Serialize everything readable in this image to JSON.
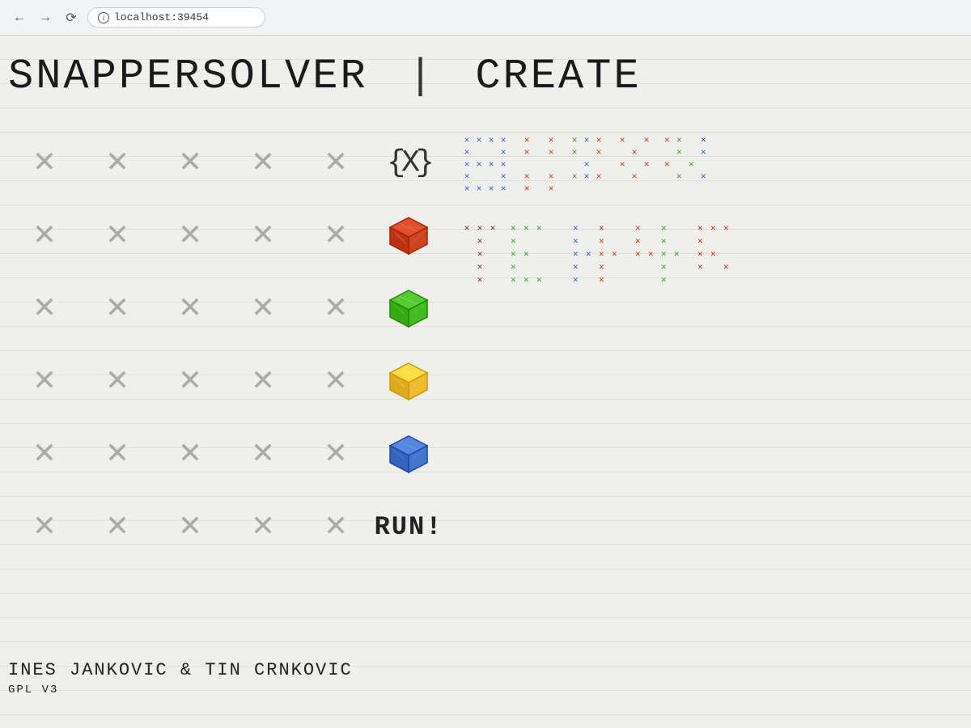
{
  "browser": {
    "url": "localhost:39454",
    "info_symbol": "i"
  },
  "page": {
    "title_left": "SNAPPERSOLVER",
    "title_sep": "|",
    "title_right": "CREATE",
    "curly_label": "{X}",
    "run_label": "RUN!",
    "author": "INES JANKOVIC & TIN CRNKOVIC",
    "license": "GPL V3"
  },
  "cubes": {
    "red": "#cc3300",
    "green": "#44aa22",
    "yellow": "#ffcc00",
    "blue": "#3366cc"
  },
  "grid": {
    "rows": 7,
    "cols": 6,
    "x_color": "#aaaaaa",
    "special_col5_rows": [
      "curly",
      "red_cube",
      "green_cube",
      "yellow_cube",
      "blue_cube",
      "run"
    ]
  }
}
